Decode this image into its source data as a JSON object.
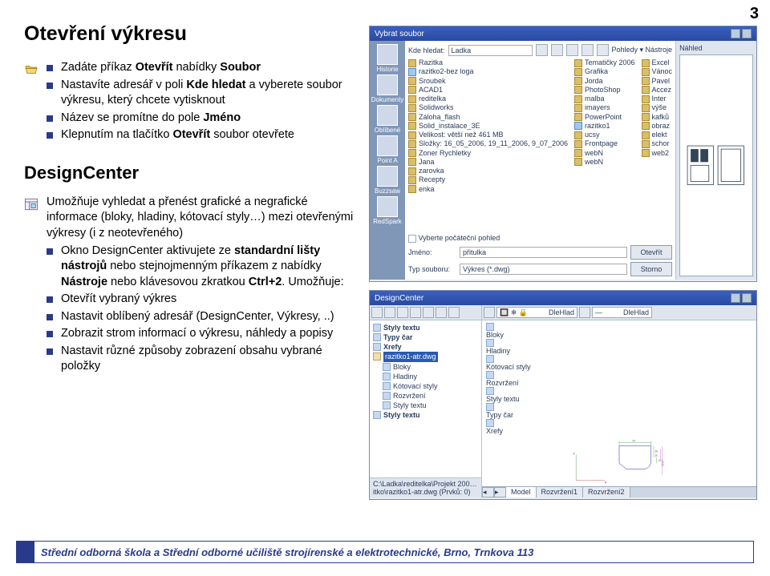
{
  "page_number": "3",
  "section1": {
    "title": "Otevření výkresu",
    "bullets": [
      "Zadáte příkaz <b>Otevřít</b> nabídky <b>Soubor</b>",
      "Nastavíte adresář v poli <b>Kde hledat</b> a vyberete soubor výkresu, který chcete vytisknout",
      "Název se promítne do pole <b>Jméno</b>",
      "Klepnutím na tlačítko <b>Otevřít</b> soubor otevřete"
    ]
  },
  "section2": {
    "title": "DesignCenter",
    "lead": "Umožňuje vyhledat a přenést grafické a negrafické informace (bloky, hladiny, kótovací styly…) mezi otevřenými výkresy (i z neotevřeného)",
    "bullets": [
      "Okno DesignCenter aktivujete ze <b>standardní lišty nástrojů</b> nebo stejnojmenným příkazem z nabídky <b>Nástroje</b> nebo klávesovou zkratkou <b>Ctrl+2</b>. Umožňuje:",
      "Otevřít vybraný výkres",
      "Nastavit oblíbený adresář (DesignCenter, Výkresy, ..)",
      "Zobrazit strom informací o výkresu, náhledy a popisy",
      "Nastavit různé způsoby zobrazení obsahu vybrané položky"
    ]
  },
  "dialog1": {
    "title": "Vybrat soubor",
    "lookin_label": "Kde hledat:",
    "lookin_value": "Ladka",
    "sidebar": [
      "Historie",
      "Dokumenty",
      "Oblíbené",
      "Point A",
      "Buzzsaw",
      "RedSpark"
    ],
    "preview_label": "Náhled",
    "col1": [
      "Razitka",
      "razitko2-bez loga",
      "Sroubek",
      "ACAD1",
      "reditelka",
      "Solidworks",
      "Záloha_flash",
      "Solid_instalace_3E",
      "Velikost: větší než 461 MB",
      "Složky: 16_05_2006, 19_11_2006, 9_07_2006",
      "Zoner Rychletky",
      "Jana",
      "zarovka",
      "Recepty",
      "enka"
    ],
    "col2": [
      "Tematičky 2006",
      "Grafika",
      "Jorda",
      "PhotoShop",
      "malba",
      "imayers",
      "PowerPoint",
      "razitko1",
      "ucsy",
      "Frontpage",
      "webN",
      "webN"
    ],
    "col3": [
      "Excel",
      "Vánoc",
      "Pavel",
      "Accez",
      "Inter",
      "výše",
      "kafků",
      "obraz",
      "elekt",
      "schor",
      "web2"
    ],
    "checkbox": "Vyberte počáteční pohled",
    "name_label": "Jméno:",
    "name_value": "přitulka",
    "type_label": "Typ souboru:",
    "type_value": "Výkres (*.dwg)",
    "open_btn": "Otevřít",
    "cancel_btn": "Storno",
    "menu_right": "Pohledy   ▾   Nástroje"
  },
  "dialog2": {
    "title": "DesignCenter",
    "dropdown1": "DleHlad",
    "dropdown2": "DleHlad",
    "tree": [
      {
        "lvl": 0,
        "ico": "leaf",
        "label": "Styly textu",
        "bold": true
      },
      {
        "lvl": 0,
        "ico": "leaf",
        "label": "Typy čar",
        "bold": true
      },
      {
        "lvl": 0,
        "ico": "leaf",
        "label": "Xrefy",
        "bold": true
      },
      {
        "lvl": 0,
        "ico": "dwg",
        "label": "razitko1-atr.dwg",
        "bold": false,
        "sel": true
      },
      {
        "lvl": 1,
        "ico": "leaf",
        "label": "Bloky"
      },
      {
        "lvl": 1,
        "ico": "leaf",
        "label": "Hladiny"
      },
      {
        "lvl": 1,
        "ico": "leaf",
        "label": "Kótovací styly"
      },
      {
        "lvl": 1,
        "ico": "leaf",
        "label": "Rozvržení"
      },
      {
        "lvl": 1,
        "ico": "leaf",
        "label": "Styly textu"
      },
      {
        "lvl": 0,
        "ico": "leaf",
        "label": "Styly textu",
        "bold": true
      }
    ],
    "right_list": [
      "Bloky",
      "Hladiny",
      "Kótovací styly",
      "Rozvržení",
      "Styly textu",
      "Typy čar",
      "Xrefy"
    ],
    "dim_top": "54",
    "dim1": "38",
    "dim2": "12,7",
    "dim3": "30",
    "dim4": "50,8",
    "axis_x": "X",
    "axis_y": "Y",
    "status": "C:\\Ladka\\reditelka\\Projekt 200…itko\\razitko1-atr.dwg (Prvků: 0)",
    "tabs": [
      "Model",
      "Rozvržení1",
      "Rozvržení2"
    ]
  },
  "footer": "Střední odborná škola a Střední odborné učiliště strojírenské a elektrotechnické, Brno, Trnkova 113"
}
